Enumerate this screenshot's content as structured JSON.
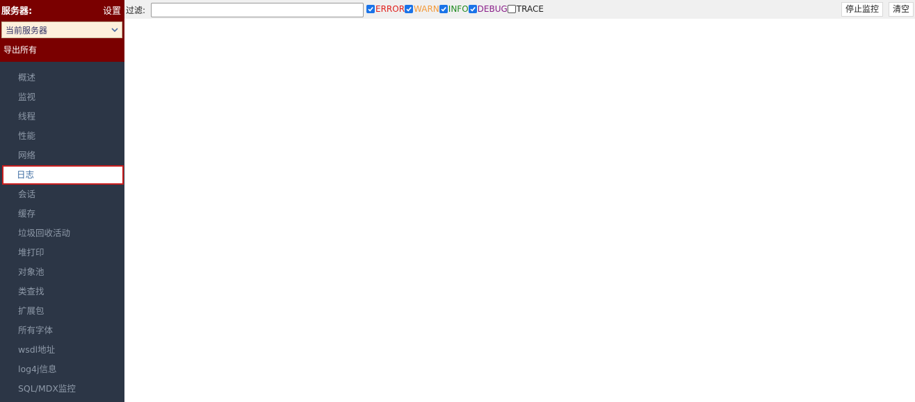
{
  "sidebar": {
    "title": "服务器:",
    "settings_label": "设置",
    "server_select": {
      "selected": "当前服务器"
    },
    "export_label": "导出所有",
    "items": [
      {
        "label": "概述"
      },
      {
        "label": "监视"
      },
      {
        "label": "线程"
      },
      {
        "label": "性能"
      },
      {
        "label": "网络"
      },
      {
        "label": "日志",
        "active": true
      },
      {
        "label": "会话"
      },
      {
        "label": "缓存"
      },
      {
        "label": "垃圾回收活动"
      },
      {
        "label": "堆打印"
      },
      {
        "label": "对象池"
      },
      {
        "label": "类查找"
      },
      {
        "label": "扩展包"
      },
      {
        "label": "所有字体"
      },
      {
        "label": "wsdl地址"
      },
      {
        "label": "log4j信息"
      },
      {
        "label": "SQL/MDX监控"
      }
    ],
    "colors": {
      "header_bg": "#7a0000",
      "nav_bg": "#2c3646",
      "active_border": "#cc1f1f"
    }
  },
  "toolbar": {
    "filter_label": "过滤:",
    "filter_value": "",
    "levels": [
      {
        "label": "ERROR",
        "checked": true,
        "color": "#e0201c"
      },
      {
        "label": "WARN",
        "checked": true,
        "color": "#f39a3a"
      },
      {
        "label": "INFO",
        "checked": true,
        "color": "#1f8a1f"
      },
      {
        "label": "DEBUG",
        "checked": true,
        "color": "#8a1f8a"
      },
      {
        "label": "TRACE",
        "checked": false,
        "color": "#222222"
      }
    ],
    "stop_label": "停止监控",
    "clear_label": "清空"
  }
}
